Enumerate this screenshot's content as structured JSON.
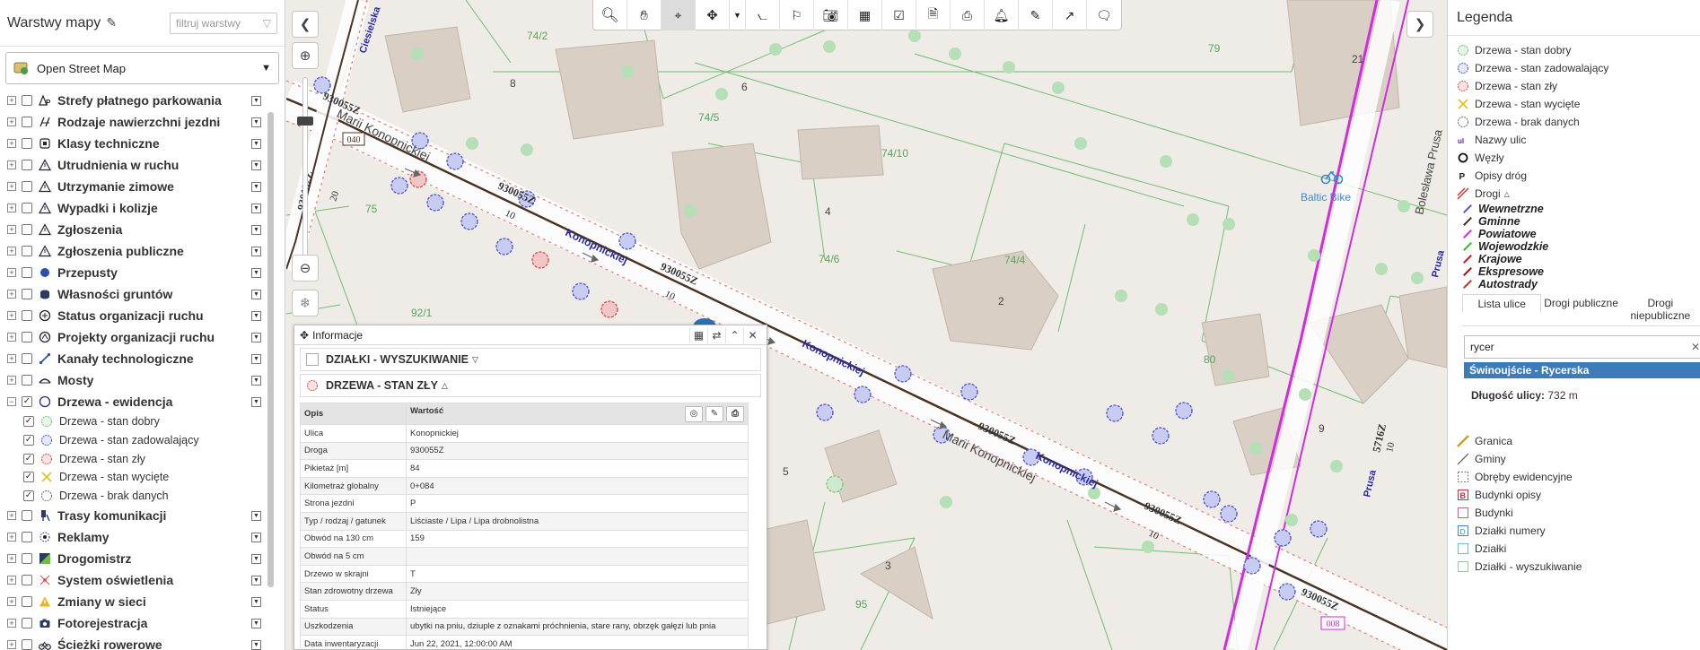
{
  "left_panel": {
    "title": "Warstwy mapy",
    "filter_placeholder": "filtruj warstwy",
    "basemap": "Open Street Map",
    "layers": [
      {
        "label": "Strefy płatnego parkowania",
        "checked": false,
        "icon": "parking-zone-icon",
        "sub": false
      },
      {
        "label": "Rodzaje nawierzchni jezdni",
        "checked": false,
        "icon": "road-surface-icon",
        "sub": false
      },
      {
        "label": "Klasy techniczne",
        "checked": false,
        "icon": "technical-class-icon",
        "sub": false
      },
      {
        "label": "Utrudnienia w ruchu",
        "checked": false,
        "icon": "warning-triangle-icon",
        "sub": false
      },
      {
        "label": "Utrzymanie zimowe",
        "checked": false,
        "icon": "warning-triangle-icon",
        "sub": false
      },
      {
        "label": "Wypadki i kolizje",
        "checked": false,
        "icon": "warning-triangle-icon",
        "sub": false
      },
      {
        "label": "Zgłoszenia",
        "checked": false,
        "icon": "warning-triangle-icon",
        "sub": false
      },
      {
        "label": "Zgłoszenia publiczne",
        "checked": false,
        "icon": "warning-triangle-icon",
        "sub": false
      },
      {
        "label": "Przepusty",
        "checked": false,
        "icon": "culvert-icon",
        "sub": false
      },
      {
        "label": "Własności gruntów",
        "checked": false,
        "icon": "land-ownership-icon",
        "sub": false
      },
      {
        "label": "Status organizacji ruchu",
        "checked": false,
        "icon": "traffic-status-icon",
        "sub": false
      },
      {
        "label": "Projekty organizacji ruchu",
        "checked": false,
        "icon": "traffic-project-icon",
        "sub": false
      },
      {
        "label": "Kanały technologiczne",
        "checked": false,
        "icon": "technology-channel-icon",
        "sub": false
      },
      {
        "label": "Mosty",
        "checked": false,
        "icon": "bridge-icon",
        "sub": false
      },
      {
        "label": "Drzewa - ewidencja",
        "checked": true,
        "icon": "tree-registry-icon",
        "sub": false,
        "expanded": true
      },
      {
        "label": "Drzewa - stan dobry",
        "checked": true,
        "icon": "tree-good-icon",
        "sub": true
      },
      {
        "label": "Drzewa - stan zadowalający",
        "checked": true,
        "icon": "tree-satisfactory-icon",
        "sub": true
      },
      {
        "label": "Drzewa - stan zły",
        "checked": true,
        "icon": "tree-bad-icon",
        "sub": true
      },
      {
        "label": "Drzewa - stan wycięte",
        "checked": true,
        "icon": "tree-cut-icon",
        "sub": true
      },
      {
        "label": "Drzewa - brak danych",
        "checked": true,
        "icon": "tree-nodata-icon",
        "sub": true
      },
      {
        "label": "Trasy komunikacji",
        "checked": false,
        "icon": "transit-route-icon",
        "sub": false
      },
      {
        "label": "Reklamy",
        "checked": false,
        "icon": "advertisement-icon",
        "sub": false
      },
      {
        "label": "Drogomistrz",
        "checked": false,
        "icon": "road-master-icon",
        "sub": false
      },
      {
        "label": "System oświetlenia",
        "checked": false,
        "icon": "lighting-icon",
        "sub": false
      },
      {
        "label": "Zmiany w sieci",
        "checked": false,
        "icon": "network-change-icon",
        "sub": false
      },
      {
        "label": "Fotorejestracja",
        "checked": false,
        "icon": "camera-icon",
        "sub": false
      },
      {
        "label": "Ścieżki rowerowe",
        "checked": false,
        "icon": "bike-path-icon",
        "sub": false
      }
    ]
  },
  "toolbar": {
    "tools": [
      "search-icon",
      "pan-hand-icon",
      "location-pin-icon",
      "move-icon",
      "dropdown-icon",
      "measure-icon",
      "survey-icon",
      "camera-icon",
      "table-icon",
      "checklist-icon",
      "report-icon",
      "print-icon",
      "bell-icon",
      "pencil-icon",
      "export-icon",
      "comment-icon"
    ],
    "active": "location-pin-icon"
  },
  "map": {
    "labels": {
      "parcel_742": "74/2",
      "parcel_745": "74/5",
      "parcel_7410": "74/10",
      "parcel_746": "74/6",
      "parcel_744": "74/4",
      "parcel_79": "79",
      "parcel_80": "80",
      "parcel_75": "75",
      "parcel_921": "92/1",
      "parcel_95": "95",
      "house_8": "8",
      "house_6": "6",
      "house_4": "4",
      "house_2": "2",
      "house_21": "21",
      "house_9": "9",
      "house_5": "5",
      "house_3": "3",
      "street_konopnickiej_1": "Konopnickiej",
      "street_konopnickiej_2": "Konopnickiej",
      "street_konopnickiej_3": "Konopnickiej",
      "street_konopnickiej_4": "Konopnickiej",
      "street_marii_1": "Marii Konopnickiej",
      "street_marii_2": "Marii Konopnickiej",
      "street_ciesielska": "Ciesielska",
      "street_prusa": "Bolesława Prusa",
      "street_prusa_short": "Prusa",
      "street_prusa_2": "Prusa",
      "road_9300_1": "930055Z",
      "road_9300_2": "930055Z",
      "road_9300_3": "930055Z",
      "road_9300_4": "930055Z",
      "road_9300_5": "930055Z",
      "road_9300_6": "930055Z",
      "road_930132": "930132Z",
      "road_5716": "5716Z",
      "speed_20": "20",
      "speed_10_a": "10",
      "speed_10_b": "10",
      "speed_10_c": "10",
      "speed_10_d": "10",
      "node_040": "040",
      "node_008": "008",
      "poi_baltic": "Baltic Bike"
    },
    "colors": {
      "road_brown": "#4a3423",
      "road_magenta": "#d02edb",
      "tree_blue": "#4a54c8",
      "tree_red": "#d84a4a",
      "tree_green": "#6bbf6b",
      "parcel_green": "#6fbf6f",
      "building": "#d9cfc5",
      "street_label": "#2a2aa8"
    }
  },
  "info_popup": {
    "title": "Informacje",
    "sections": [
      "DZIAŁKI - WYSZUKIWANIE",
      "DRZEWA - STAN ZŁY"
    ],
    "columns": [
      "Opis",
      "Wartość"
    ],
    "rows": [
      [
        "Ulica",
        "Konopnickiej"
      ],
      [
        "Droga",
        "930055Z"
      ],
      [
        "Pikietaż [m]",
        "84"
      ],
      [
        "Kilometraż globalny",
        "0+084"
      ],
      [
        "Strona jezdni",
        "P"
      ],
      [
        "Typ / rodzaj / gatunek",
        "Liściaste / Lipa / Lipa drobnolistna"
      ],
      [
        "Obwód na 130 cm",
        "159"
      ],
      [
        "Obwód na 5 cm",
        ""
      ],
      [
        "Drzewo w skrajni",
        "T"
      ],
      [
        "Stan zdrowotny drzewa",
        "Zły"
      ],
      [
        "Status",
        "Istniejące"
      ],
      [
        "Uszkodzenia",
        "ubytki na pniu, dziuple z oznakami próchnienia, stare rany, obrzęk gałęzi lub pnia"
      ],
      [
        "Data inwentaryzacji",
        "Jun 22, 2021, 12:00:00 AM"
      ]
    ]
  },
  "legend": {
    "title": "Legenda",
    "items_top": [
      {
        "label": "Drzewa - stan dobry",
        "icon": "tree-good-icon"
      },
      {
        "label": "Drzewa - stan zadowalający",
        "icon": "tree-satisfactory-icon"
      },
      {
        "label": "Drzewa - stan zły",
        "icon": "tree-bad-icon"
      },
      {
        "label": "Drzewa - stan wycięte",
        "icon": "tree-cut-icon"
      },
      {
        "label": "Drzewa - brak danych",
        "icon": "tree-nodata-icon"
      },
      {
        "label": "Nazwy ulic",
        "icon": "street-names-icon"
      },
      {
        "label": "Węzły",
        "icon": "node-icon"
      },
      {
        "label": "Opisy dróg",
        "icon": "road-desc-icon"
      },
      {
        "label": "Drogi",
        "icon": "roads-icon"
      }
    ],
    "roads": [
      {
        "label": "Wewnetrzne",
        "color": "#5a5ad0"
      },
      {
        "label": "Gminne",
        "color": "#4a3423"
      },
      {
        "label": "Powiatowe",
        "color": "#d02edb"
      },
      {
        "label": "Wojewodzkie",
        "color": "#2fbf2f"
      },
      {
        "label": "Krajowe",
        "color": "#c81e1e"
      },
      {
        "label": "Ekspresowe",
        "color": "#b01010"
      },
      {
        "label": "Autostrady",
        "color": "#c83232"
      }
    ],
    "tabs": [
      "Lista ulice",
      "Drogi publiczne",
      "Drogi niepubliczne"
    ],
    "search_value": "rycer",
    "result": "Świnoujście - Rycerska",
    "length_label": "Długość ulicy:",
    "length_value": "732 m",
    "items_bottom": [
      {
        "label": "Granica",
        "icon": "boundary-icon"
      },
      {
        "label": "Gminy",
        "icon": "municipality-icon"
      },
      {
        "label": "Obręby ewidencyjne",
        "icon": "precinct-icon"
      },
      {
        "label": "Budynki opisy",
        "icon": "building-desc-icon"
      },
      {
        "label": "Budynki",
        "icon": "building-icon"
      },
      {
        "label": "Działki numery",
        "icon": "parcel-number-icon"
      },
      {
        "label": "Działki",
        "icon": "parcel-icon"
      },
      {
        "label": "Działki - wyszukiwanie",
        "icon": "parcel-search-icon"
      }
    ]
  }
}
